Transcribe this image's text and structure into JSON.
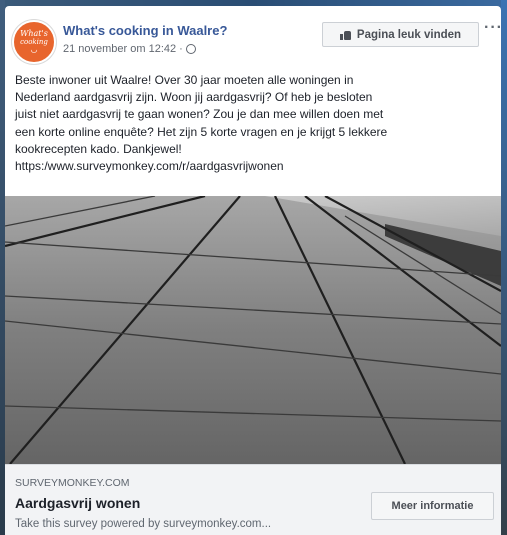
{
  "post": {
    "page_name": "What's cooking in Waalre?",
    "date": "21 november om 12:42 ·",
    "like_page_label": "Pagina leuk vinden",
    "more_label": "···",
    "avatar": {
      "line1": "What's",
      "line2": "cooking"
    },
    "text_lines": [
      "Beste inwoner uit Waalre! Over 30 jaar moeten alle woningen in",
      "Nederland aardgasvrij zijn. Woon jij aardgasvrij? Of heb je besloten",
      "juist niet aardgasvrij te gaan wonen? Zou je dan mee willen doen met",
      "een korte online enquête? Het zijn 5 korte vragen en je krijgt 5 lekkere",
      "kookrecepten kado. Dankjewel!",
      "https:/www.surveymonkey.com/r/aardgasvrijwonen"
    ]
  },
  "link_preview": {
    "domain": "SURVEYMONKEY.COM",
    "title": "Aardgasvrij wonen",
    "description": "Take this survey powered by surveymonkey.com...",
    "cta_label": "Meer informatie"
  },
  "colors": {
    "page_name": "#385898",
    "avatar": "#e8652d",
    "link_box_bg": "#f2f3f5"
  }
}
